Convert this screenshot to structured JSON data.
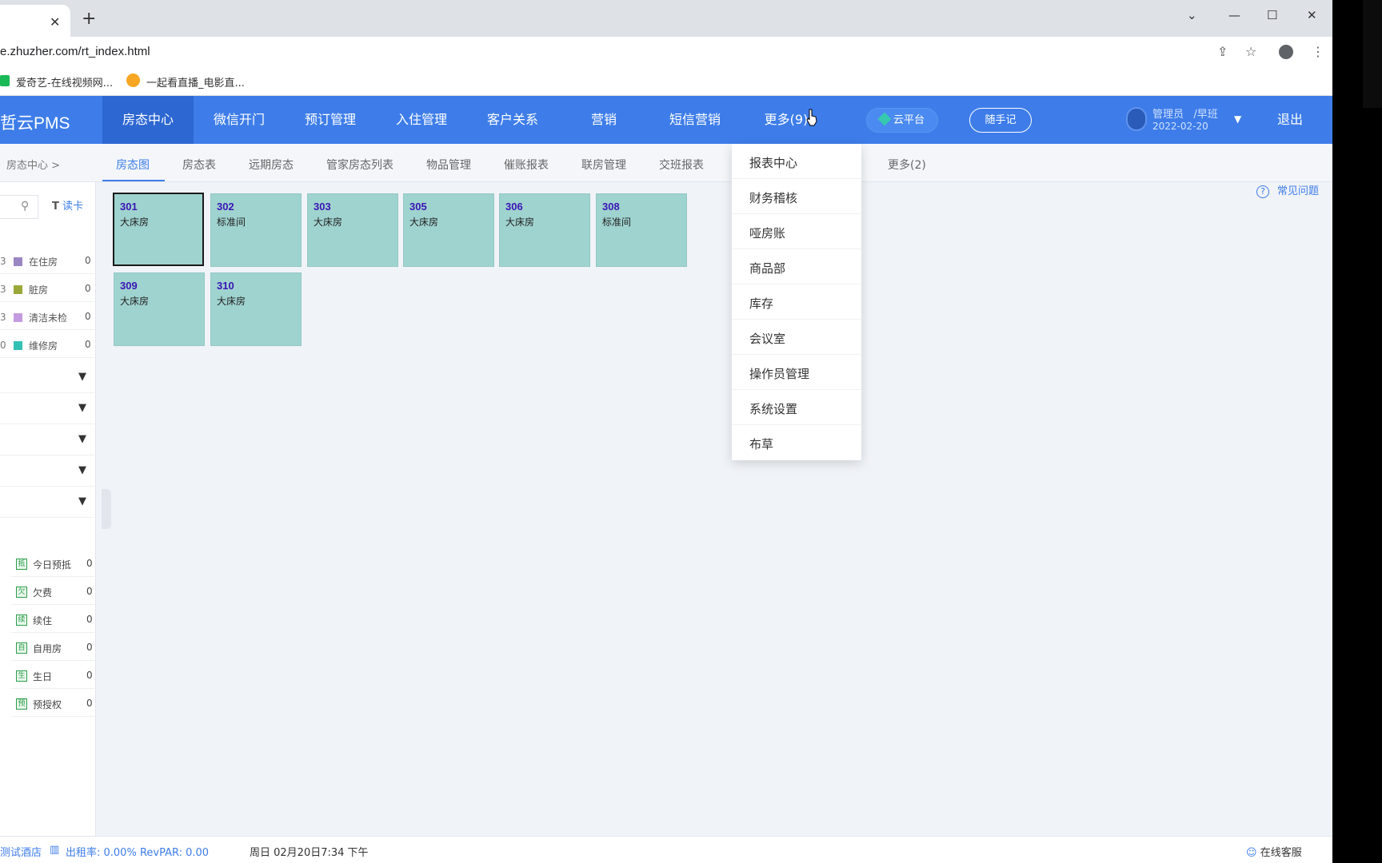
{
  "browser": {
    "tab_close": "✕",
    "new_tab": "+",
    "url": "e.zhuzher.com/rt_index.html",
    "bookmarks": [
      "爱奇艺-在线视频网...",
      "一起看直播_电影直..."
    ]
  },
  "app": {
    "logo": "哲云PMS",
    "nav": [
      "房态中心",
      "微信开门",
      "预订管理",
      "入住管理",
      "客户关系",
      "营销",
      "短信营销",
      "更多(9)"
    ],
    "cloud_platform": "云平台",
    "memo": "随手记",
    "user": {
      "name": "管理员",
      "shift": "/早班",
      "date": "2022-02-20"
    },
    "logout": "退出"
  },
  "subnav": {
    "breadcrumb": "房态中心  >",
    "tabs": [
      "房态图",
      "房态表",
      "远期房态",
      "管家房态列表",
      "物品管理",
      "催账报表",
      "联房管理",
      "交班报表",
      "更多(2)"
    ]
  },
  "sidebar": {
    "read_card": "读卡",
    "statuses": [
      {
        "lead": "3",
        "label": "在住房",
        "count": "0",
        "color": "#9b86c4"
      },
      {
        "lead": "3",
        "label": "脏房",
        "count": "0",
        "color": "#9aa83a"
      },
      {
        "lead": "3",
        "label": "清洁未检",
        "count": "0",
        "color": "#c49be0"
      },
      {
        "lead": "0",
        "label": "维修房",
        "count": "0",
        "color": "#33c0b4"
      }
    ],
    "tags": [
      {
        "icon": "抵",
        "label": "今日预抵",
        "count": "0"
      },
      {
        "icon": "欠",
        "label": "欠费",
        "count": "0"
      },
      {
        "icon": "续",
        "label": "续住",
        "count": "0"
      },
      {
        "icon": "自",
        "label": "自用房",
        "count": "0"
      },
      {
        "icon": "生",
        "label": "生日",
        "count": "0"
      },
      {
        "icon": "预",
        "label": "预授权",
        "count": "0"
      }
    ]
  },
  "main": {
    "help": "常见问题",
    "rooms": [
      {
        "number": "301",
        "type": "大床房"
      },
      {
        "number": "302",
        "type": "标准间"
      },
      {
        "number": "303",
        "type": "大床房"
      },
      {
        "number": "305",
        "type": "大床房"
      },
      {
        "number": "306",
        "type": "大床房"
      },
      {
        "number": "308",
        "type": "标准间"
      },
      {
        "number": "309",
        "type": "大床房"
      },
      {
        "number": "310",
        "type": "大床房"
      }
    ]
  },
  "more_menu": [
    "报表中心",
    "财务稽核",
    "哑房账",
    "商品部",
    "库存",
    "会议室",
    "操作员管理",
    "系统设置",
    "布草"
  ],
  "statusbar": {
    "hotel": "测试酒店",
    "occupancy": "出租率: 0.00% RevPAR: 0.00",
    "datetime": "周日 02月20日7:34 下午",
    "online_service": "在线客服"
  }
}
